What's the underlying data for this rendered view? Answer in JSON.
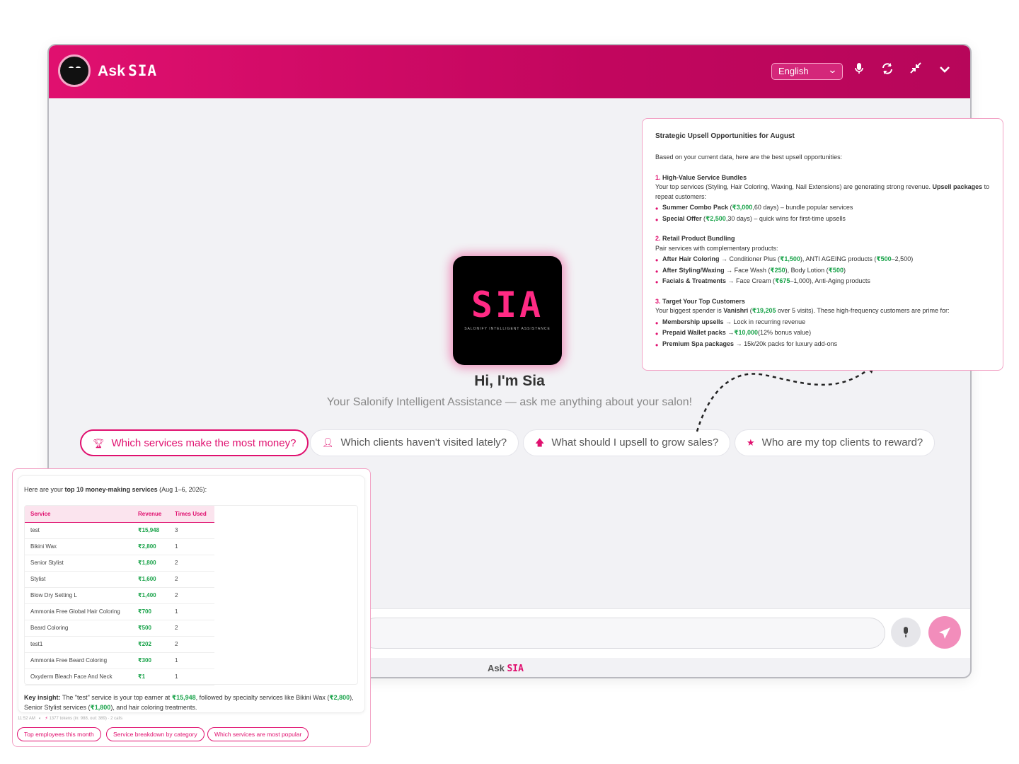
{
  "header": {
    "brand_ask": "Ask",
    "brand_sia": "SIA",
    "language": "English"
  },
  "hero": {
    "logo_text": "SIA",
    "logo_tagline": "SALONIFY INTELLIGENT ASSISTANCE",
    "greeting": "Hi, I'm Sia",
    "subtitle": "Your Salonify Intelligent Assistance — ask me anything about your salon!"
  },
  "chips": [
    {
      "label": "Which services make the most money?",
      "icon": "trophy-icon"
    },
    {
      "label": "Which clients haven't visited lately?",
      "icon": "user-plus-icon"
    },
    {
      "label": "What should I upsell to grow sales?",
      "icon": "arrow-up-icon"
    },
    {
      "label": "Who are my top clients to reward?",
      "icon": "star-icon"
    }
  ],
  "footer": {
    "brand_ask": "Ask",
    "brand_sia": "SIA"
  },
  "upsell": {
    "title": "Strategic Upsell Opportunities for August",
    "intro": "Based on your current data, here are the best upsell opportunities:",
    "s1": {
      "num": "1.",
      "heading": "High-Value Service Bundles",
      "text_a": "Your top services (Styling, Hair Coloring, Waxing, Nail Extensions) are generating strong revenue.",
      "text_b": "Upsell packages",
      "text_c": "to repeat customers:",
      "b1_label": "Summer Combo Pack",
      "b1_open": " (",
      "b1_price": "₹3,000",
      "b1_rest": ",60 days) – bundle popular services",
      "b2_label": "Special Offer",
      "b2_open": " (",
      "b2_price": "₹2,500",
      "b2_rest": ",30 days) – quick wins for first-time upsells"
    },
    "s2": {
      "num": "2.",
      "heading": "Retail Product Bundling",
      "text": "Pair services with complementary products:",
      "b1_label": "After Hair Coloring",
      "b1_a": " → Conditioner Plus (",
      "b1_p1": "₹1,500",
      "b1_b": "), ANTI AGEING products (",
      "b1_p2": "₹500",
      "b1_c": "–2,500)",
      "b2_label": "After Styling/Waxing",
      "b2_a": " → Face Wash (",
      "b2_p1": "₹250",
      "b2_b": "), Body Lotion (",
      "b2_p2": "₹500",
      "b2_c": ")",
      "b3_label": "Facials & Treatments",
      "b3_a": " → Face Cream (",
      "b3_p1": "₹675",
      "b3_b": "–1,000), Anti-Aging products"
    },
    "s3": {
      "num": "3.",
      "heading": "Target Your Top Customers",
      "text_a": "Your biggest spender is ",
      "name": "Vanishri",
      "text_b": " (",
      "price": "₹19,205",
      "text_c": " over 5 visits). These high-frequency customers are prime for:",
      "b1_label": "Membership upsells",
      "b1_rest": " → Lock in recurring revenue",
      "b2_label": "Prepaid Wallet packs",
      "b2_a": " →",
      "b2_price": "₹10,000",
      "b2_rest": "(12% bonus value)",
      "b3_label": "Premium Spa packages",
      "b3_rest": " → 15k/20k packs for luxury add-ons"
    }
  },
  "services": {
    "intro_a": "Here are your ",
    "intro_b": "top 10 money-making services",
    "intro_c": " (Aug 1–6, 2026):",
    "columns": [
      "Service",
      "Revenue",
      "Times Used"
    ],
    "rows": [
      [
        "test",
        "₹15,948",
        "3"
      ],
      [
        "Bikini Wax",
        "₹2,800",
        "1"
      ],
      [
        "Senior Stylist",
        "₹1,800",
        "2"
      ],
      [
        "Stylist",
        "₹1,600",
        "2"
      ],
      [
        "Blow Dry Setting L",
        "₹1,400",
        "2"
      ],
      [
        "Ammonia Free Global Hair Coloring",
        "₹700",
        "1"
      ],
      [
        "Beard Coloring",
        "₹500",
        "2"
      ],
      [
        "test1",
        "₹202",
        "2"
      ],
      [
        "Ammonia Free Beard Coloring",
        "₹300",
        "1"
      ],
      [
        "Oxyderm Bleach Face And Neck",
        "₹1",
        "1"
      ]
    ],
    "insight_label": "Key insight:",
    "insight_a": " The \"test\" service is your top earner at ",
    "insight_p1": "₹15,948",
    "insight_b": ", followed by specialty services like Bikini Wax (",
    "insight_p2": "₹2,800",
    "insight_c": "), Senior Stylist services (",
    "insight_p3": "₹1,800",
    "insight_d": "), and hair coloring treatments.",
    "meta_time": "11:52 AM",
    "meta_tokens": "1377 tokens (in: 988, out: 389) · 2 calls",
    "suggestions": [
      "Top employees this month",
      "Service breakdown by category",
      "Which services are most popular"
    ]
  }
}
